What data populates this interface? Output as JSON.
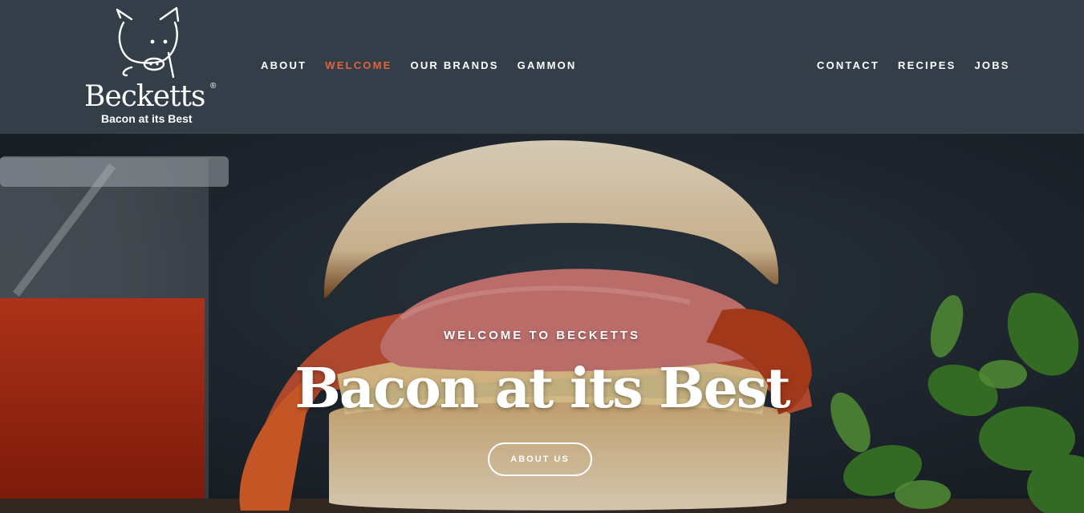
{
  "brand": {
    "name": "Becketts",
    "registered": "®",
    "tagline": "Bacon at its Best"
  },
  "nav": {
    "left": [
      {
        "label": "ABOUT",
        "active": false
      },
      {
        "label": "WELCOME",
        "active": true
      },
      {
        "label": "OUR BRANDS",
        "active": false
      },
      {
        "label": "GAMMON",
        "active": false
      }
    ],
    "right": [
      {
        "label": "CONTACT",
        "active": false
      },
      {
        "label": "RECIPES",
        "active": false
      },
      {
        "label": "JOBS",
        "active": false
      }
    ]
  },
  "hero": {
    "kicker": "WELCOME TO BECKETTS",
    "title": "Bacon at its Best",
    "button_label": "ABOUT US"
  },
  "colors": {
    "header_bg": "#333e49",
    "accent": "#e1633a",
    "text": "#ffffff"
  }
}
